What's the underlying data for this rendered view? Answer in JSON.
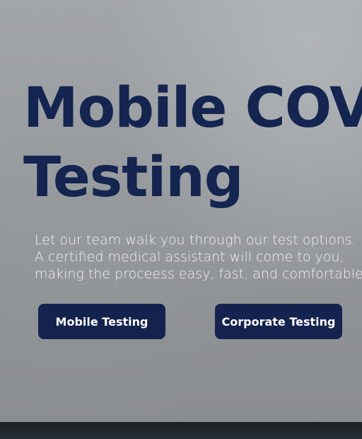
{
  "hero": {
    "title_line1": "Mobile COV",
    "title_line2": "Testing",
    "description": {
      "line1": "Let our team walk you through our test options.",
      "line2": "A certified medical assistant will come to you,",
      "line3": "making the proceess easy, fast, and comfortable."
    },
    "buttons": {
      "mobile_label": "Mobile Testing",
      "corporate_label": "Corporate Testing"
    }
  },
  "colors": {
    "title": "#132550",
    "button_bg": "#14234e",
    "button_text": "#ffffff",
    "description_text": "#f2f3f4"
  }
}
